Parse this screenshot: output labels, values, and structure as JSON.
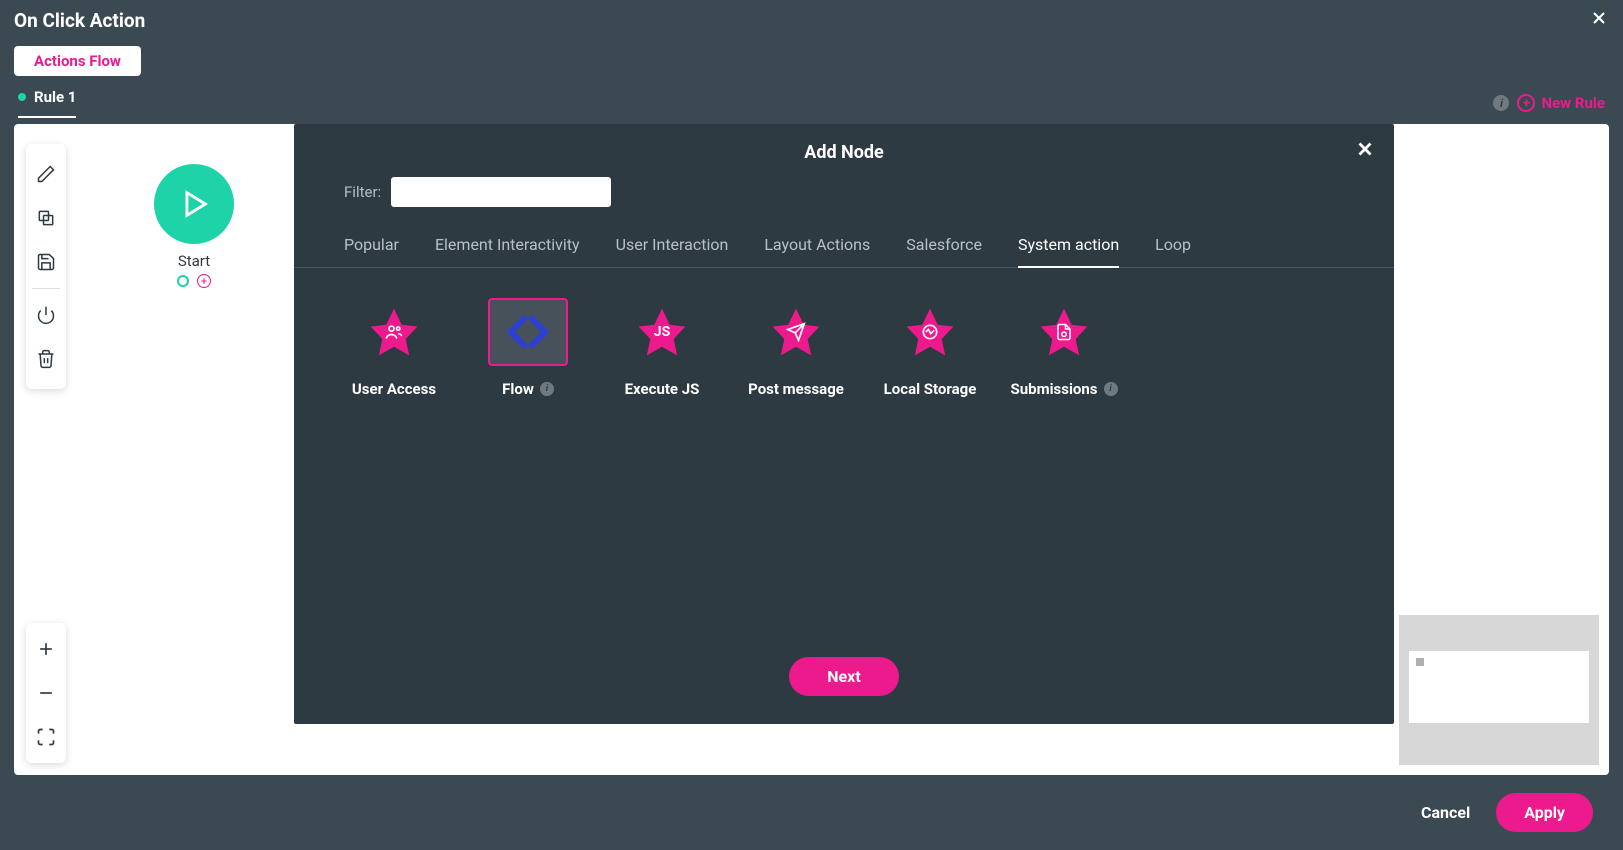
{
  "window": {
    "title": "On Click Action"
  },
  "header": {
    "flow_btn": "Actions Flow"
  },
  "rules": {
    "tab_label": "Rule 1",
    "new_rule_label": "New Rule"
  },
  "canvas": {
    "start_label": "Start"
  },
  "modal": {
    "title": "Add Node",
    "filter_label": "Filter:",
    "filter_value": "",
    "tabs": [
      {
        "label": "Popular",
        "active": false
      },
      {
        "label": "Element Interactivity",
        "active": false
      },
      {
        "label": "User Interaction",
        "active": false
      },
      {
        "label": "Layout Actions",
        "active": false
      },
      {
        "label": "Salesforce",
        "active": false
      },
      {
        "label": "System action",
        "active": true
      },
      {
        "label": "Loop",
        "active": false
      }
    ],
    "nodes": [
      {
        "label": "User Access",
        "icon": "user-access",
        "selected": false,
        "info": false
      },
      {
        "label": "Flow",
        "icon": "flow",
        "selected": true,
        "info": true
      },
      {
        "label": "Execute JS",
        "icon": "js",
        "selected": false,
        "info": false
      },
      {
        "label": "Post message",
        "icon": "send",
        "selected": false,
        "info": false
      },
      {
        "label": "Local Storage",
        "icon": "storage",
        "selected": false,
        "info": false
      },
      {
        "label": "Submissions",
        "icon": "submissions",
        "selected": false,
        "info": true
      }
    ],
    "next_btn": "Next"
  },
  "footer": {
    "cancel": "Cancel",
    "apply": "Apply"
  }
}
